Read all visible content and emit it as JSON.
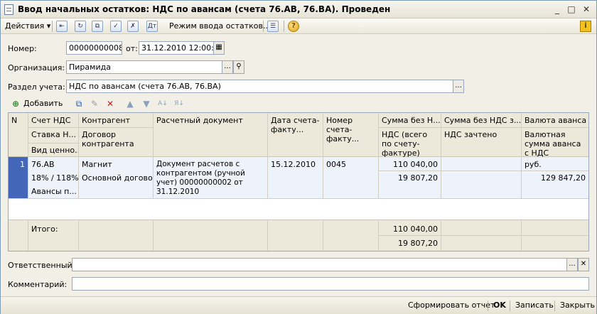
{
  "window": {
    "title": "Ввод начальных остатков: НДС по авансам (счета 76.АВ, 76.ВА). Проведен",
    "minimize": "_",
    "maximize": "□",
    "close": "✕"
  },
  "toolbar": {
    "actions_label": "Действия",
    "mode_label": "Режим ввода остатков...",
    "help": "?",
    "info": "i"
  },
  "form": {
    "number_label": "Номер:",
    "number_value": "00000000008",
    "date_label": "от:",
    "date_value": "31.12.2010 12:00:07",
    "org_label": "Организация:",
    "org_value": "Пирамида",
    "section_label": "Раздел учета:",
    "section_value": "НДС по авансам (счета 76.АВ, 76.ВА)",
    "ellipsis": "...",
    "search_icon": "search-icon",
    "calendar_icon": "calendar-icon"
  },
  "grid_toolbar": {
    "add_label": "Добавить"
  },
  "table": {
    "headers": {
      "n": "N",
      "account": "Счет НДС",
      "rate": "Ставка Н...",
      "kind": "Вид ценно...",
      "counterparty": "Контрагент",
      "contract": "Договор контрагента",
      "settlement_doc": "Расчетный документ",
      "invoice_date": "Дата счета-факту...",
      "invoice_number": "Номер счета-факту...",
      "amount_wo_vat": "Сумма без Н...",
      "vat_total": "НДС (всего по счету-фактуре)",
      "amount_wo_vat2": "Сумма без НДС з...",
      "vat_credited": "НДС зачтено",
      "currency": "Валюта аванса",
      "currency_amount": "Валютная сумма аванса с НДС"
    },
    "rows": [
      {
        "n": "1",
        "account": "76.АВ",
        "rate": "18% / 118%",
        "kind": "Авансы п...",
        "counterparty": "Магнит",
        "contract": "Основной договор",
        "settlement_doc": "Документ расчетов с контрагентом (ручной учет) 00000000002 от 31.12.2010",
        "invoice_date": "15.12.2010",
        "invoice_number": "0045",
        "amount_wo_vat": "110 040,00",
        "vat_total": "19 807,20",
        "amount_wo_vat2": "",
        "vat_credited": "",
        "currency": "руб.",
        "currency_amount": "129 847,20"
      }
    ],
    "totals": {
      "label": "Итого:",
      "amount_wo_vat": "110 040,00",
      "vat_total": "19 807,20"
    }
  },
  "bottom_fields": {
    "responsible_label": "Ответственный:",
    "responsible_value": "",
    "comment_label": "Комментарий:",
    "comment_value": ""
  },
  "bottom_bar": {
    "report": "Сформировать отчет",
    "ok": "OK",
    "save": "Записать",
    "close": "Закрыть"
  }
}
